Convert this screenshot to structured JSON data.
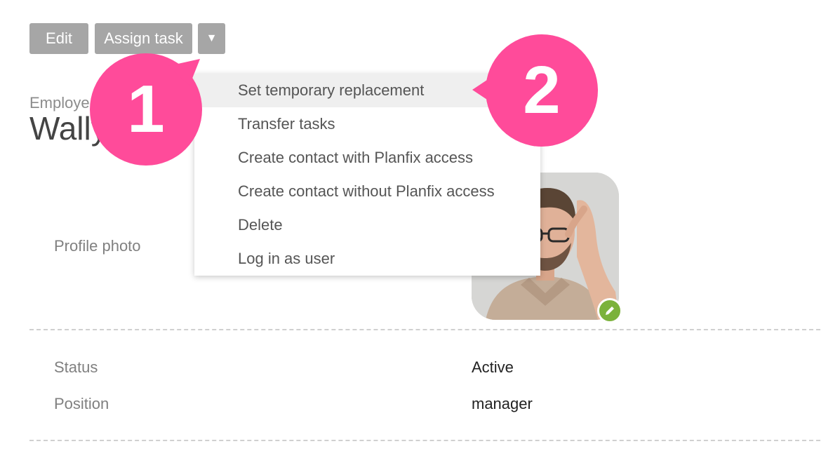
{
  "toolbar": {
    "edit_label": "Edit",
    "assign_task_label": "Assign task",
    "more_label": "▼"
  },
  "header": {
    "kind_label": "Employe",
    "name": "Wally"
  },
  "dropdown": {
    "items": [
      {
        "label": "Set temporary replacement",
        "highlighted": true
      },
      {
        "label": "Transfer tasks"
      },
      {
        "label": "Create contact with Planfix access"
      },
      {
        "label": "Create contact without Planfix access"
      },
      {
        "label": "Delete"
      },
      {
        "label": "Log in as user"
      }
    ]
  },
  "profile": {
    "photo_label": "Profile photo"
  },
  "fields": [
    {
      "label": "Status",
      "value": "Active"
    },
    {
      "label": "Position",
      "value": "manager"
    }
  ],
  "callouts": [
    {
      "number": "1"
    },
    {
      "number": "2"
    }
  ],
  "colors": {
    "button_bg": "#a6a6a6",
    "callout_pink": "#ff4b9a",
    "edit_badge": "#7bb23b"
  }
}
